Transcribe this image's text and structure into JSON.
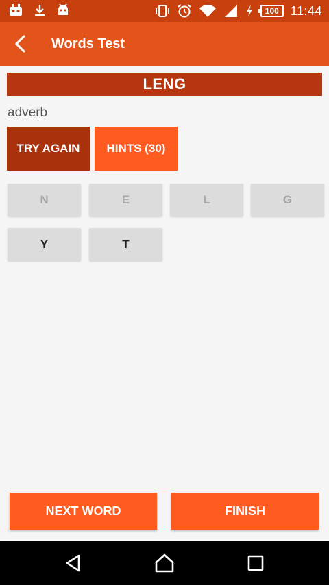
{
  "status_bar": {
    "battery_level": "100",
    "time": "11:44",
    "icons": [
      "robot-face-icon",
      "download-icon",
      "android-icon",
      "vibrate-icon",
      "alarm-icon",
      "wifi-icon",
      "signal-icon",
      "charging-icon"
    ]
  },
  "app_bar": {
    "title": "Words Test"
  },
  "word": {
    "scrambled": "LENG",
    "part_of_speech": "adverb"
  },
  "actions": {
    "try_again_label": "TRY AGAIN",
    "hints_label": "HINTS (30)"
  },
  "letters": [
    {
      "char": "N",
      "used": true
    },
    {
      "char": "E",
      "used": true
    },
    {
      "char": "L",
      "used": true
    },
    {
      "char": "G",
      "used": true
    },
    {
      "char": "Y",
      "used": false
    },
    {
      "char": "T",
      "used": false
    }
  ],
  "footer": {
    "next_label": "NEXT WORD",
    "finish_label": "FINISH"
  },
  "colors": {
    "status_bar": "#c8400e",
    "app_bar": "#e2541a",
    "banner": "#b63610",
    "primary_button": "#ff5a1f",
    "dark_button": "#a9320d",
    "tile": "#dcdcdc"
  }
}
